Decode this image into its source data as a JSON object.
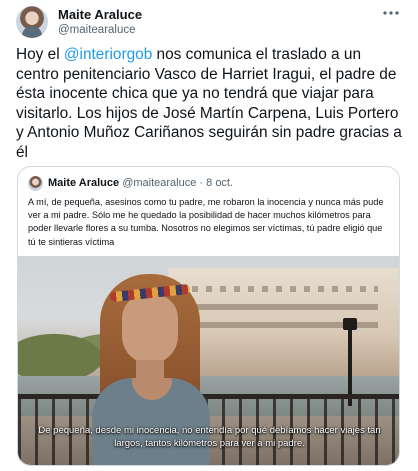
{
  "tweet": {
    "author_name": "Maite Araluce",
    "author_handle": "@maitearaluce",
    "more_icon": "more-horizontal-icon",
    "text_before_mention": "Hoy el ",
    "mention": "@interiorgob",
    "text_after_mention": " nos comunica el traslado a un centro penitenciario Vasco de Harriet Iragui, el padre de ésta inocente chica que ya no tendrá que viajar para visitarlo. Los hijos de José Martín Carpena, Luis Portero y Antonio Muñoz Cariñanos seguirán sin padre gracias a él"
  },
  "quoted_tweet": {
    "author_name": "Maite Araluce",
    "author_handle": "@maitearaluce",
    "separator": "·",
    "date": "8 oct.",
    "text": "A mí, de pequeña, asesinos como tu padre, me robaron la inocencia y nunca más pude ver a mi padre. Sólo me he quedado la posibilidad de hacer muchos kilómetros para poder llevarle flores a su tumba. Nosotros no elegimos ser víctimas, tú padre eligió que tú te sintieras víctima",
    "media_subtitle": "De pequeña, desde mi inocencia, no entendía por qué debíamos hacer viajes tan largos, tantos kilómetros para ver a mi padre."
  },
  "colors": {
    "link": "#1d9bf0",
    "text": "#0f1419",
    "secondary": "#536471",
    "border": "#cfd9de"
  }
}
